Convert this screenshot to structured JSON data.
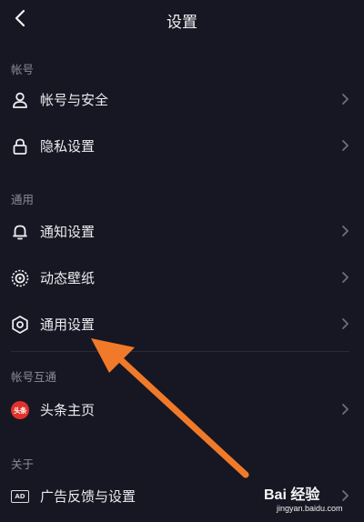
{
  "header": {
    "title": "设置",
    "back_icon": "chevron-left-icon"
  },
  "sections": {
    "account": {
      "label": "帐号",
      "items": [
        {
          "label": "帐号与安全",
          "icon": "person-icon"
        },
        {
          "label": "隐私设置",
          "icon": "lock-icon"
        }
      ]
    },
    "general": {
      "label": "通用",
      "items": [
        {
          "label": "通知设置",
          "icon": "bell-icon"
        },
        {
          "label": "动态壁纸",
          "icon": "dynamic-wallpaper-icon"
        },
        {
          "label": "通用设置",
          "icon": "gear-icon"
        }
      ]
    },
    "linked": {
      "label": "帐号互通",
      "items": [
        {
          "label": "头条主页",
          "icon": "toutiao-icon",
          "badge_text": "头条"
        }
      ]
    },
    "about": {
      "label": "关于",
      "items": [
        {
          "label": "广告反馈与设置",
          "icon": "ad-icon",
          "badge_text": "AD"
        }
      ]
    }
  },
  "annotation": {
    "arrow_color": "#f07a2a"
  },
  "watermark": {
    "brand": "Bai 经验",
    "site": "jingyan.baidu.com"
  },
  "colors": {
    "background": "#161722",
    "text": "#ececf0",
    "section_label": "#8a8b95",
    "chevron": "#6e6f7a"
  }
}
